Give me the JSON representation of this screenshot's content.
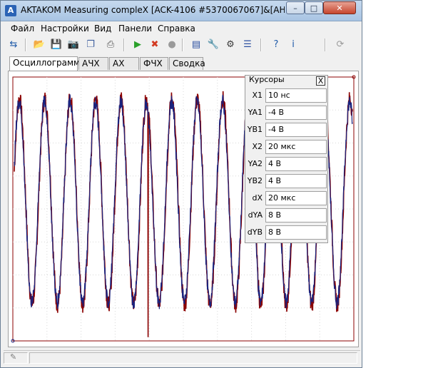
{
  "window": {
    "title": "AKTAKOM Measuring compleX [ACK-4106 #5370067067]&[AHP-41...",
    "controls": {
      "minimize": "–",
      "maximize": "□",
      "close": "✕"
    }
  },
  "menu": [
    "Файл",
    "Настройки",
    "Вид",
    "Панели",
    "Справка"
  ],
  "toolbar": {
    "buttons": [
      {
        "name": "connect-icon",
        "glyph": "⇆",
        "color": "#1e5aa8"
      },
      {
        "name": "open-folder-icon",
        "glyph": "📂",
        "color": "#d4a017"
      },
      {
        "name": "save-icon",
        "glyph": "💾",
        "color": "#2b4fa0"
      },
      {
        "name": "camera-icon",
        "glyph": "📷",
        "color": "#444444"
      },
      {
        "name": "copy-icon",
        "glyph": "❐",
        "color": "#3f5f9f"
      },
      {
        "name": "print-icon",
        "glyph": "⎙",
        "color": "#555555"
      },
      {
        "name": "run-icon",
        "glyph": "▶",
        "color": "#2aa02a"
      },
      {
        "name": "stop-icon",
        "glyph": "✖",
        "color": "#d23a22"
      },
      {
        "name": "record-icon",
        "glyph": "●",
        "color": "#9a9a9a"
      },
      {
        "name": "info-panel-icon",
        "glyph": "▤",
        "color": "#2b4fa0"
      },
      {
        "name": "tools-icon",
        "glyph": "🔧",
        "color": "#7a5a2a"
      },
      {
        "name": "scope-settings-icon",
        "glyph": "⚙",
        "color": "#3a3a3a"
      },
      {
        "name": "channel-list-icon",
        "glyph": "☰",
        "color": "#2b4fa0"
      },
      {
        "name": "help-icon",
        "glyph": "?",
        "color": "#1e5aa8"
      },
      {
        "name": "about-icon",
        "glyph": "i",
        "color": "#1e5aa8"
      },
      {
        "name": "exit-icon",
        "glyph": "⟳",
        "color": "#9a9a9a"
      }
    ]
  },
  "tabs": [
    "Осциллограммы",
    "АЧХ",
    "АХ",
    "ФЧХ",
    "Сводка"
  ],
  "cursors": {
    "title": "Курсоры",
    "close_glyph": "X",
    "rows": [
      {
        "label": "X1",
        "value": "10 нс"
      },
      {
        "label": "YA1",
        "value": "-4 В"
      },
      {
        "label": "YB1",
        "value": "-4 В"
      },
      {
        "label": "X2",
        "value": "20 мкс"
      },
      {
        "label": "YA2",
        "value": "4 В"
      },
      {
        "label": "YB2",
        "value": "4 В"
      },
      {
        "label": "dX",
        "value": "20 мкс"
      },
      {
        "label": "dYA",
        "value": "8 В"
      },
      {
        "label": "dYB",
        "value": "8 В"
      }
    ]
  },
  "chart_data": {
    "type": "line",
    "xlim": [
      0,
      20
    ],
    "ylim": [
      -5,
      5
    ],
    "grid": true,
    "series": [
      {
        "color": "#8b0000",
        "cycles": 13.3,
        "amplitude": 4.1,
        "noise": 0.35
      },
      {
        "color": "#1a237e",
        "cycles": 13.3,
        "amplitude": 4.0,
        "noise": 0.3
      }
    ]
  }
}
